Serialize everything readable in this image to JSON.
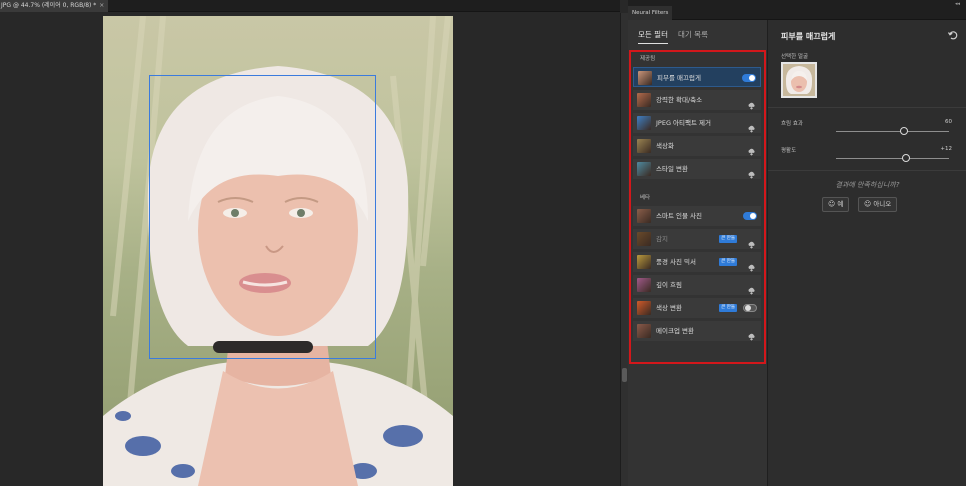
{
  "document": {
    "tab_title": "JPG @ 44.7% (레이어 0, RGB/8) *",
    "close_glyph": "×"
  },
  "panel": {
    "title": "Neural Filters",
    "tabs": [
      {
        "label": "모든 필터",
        "active": true
      },
      {
        "label": "대기 목록",
        "active": false
      }
    ],
    "sections": [
      {
        "label": "제공됨",
        "items": [
          {
            "name": "피부를 매끄럽게",
            "thumb": "#c9957a",
            "state": "toggle-on",
            "selected": true
          },
          {
            "name": "강력한 확대/축소",
            "thumb": "#b36b4c",
            "state": "cloud"
          },
          {
            "name": "JPEG 아티팩트 제거",
            "thumb": "#3f7fc4",
            "state": "cloud"
          },
          {
            "name": "색상화",
            "thumb": "#9a8452",
            "state": "cloud"
          },
          {
            "name": "스타일 변환",
            "thumb": "#4f8aa0",
            "state": "cloud"
          }
        ]
      },
      {
        "label": "베타",
        "items": [
          {
            "name": "스마트 인물 사진",
            "thumb": "#8a5e4a",
            "state": "toggle-on"
          },
          {
            "name": "감지",
            "thumb": "#6a4a2a",
            "state": "cloud",
            "badge": "큰 만들",
            "dim": true
          },
          {
            "name": "풍경 사진 믹서",
            "thumb": "#b99a3e",
            "state": "cloud",
            "badge": "큰 만들"
          },
          {
            "name": "깊이 흐림",
            "thumb": "#a05a8a",
            "state": "cloud"
          },
          {
            "name": "색상 변환",
            "thumb": "#d05a2a",
            "state": "toggle-off",
            "badge": "큰 만들"
          },
          {
            "name": "메이크업 변환",
            "thumb": "#8a5a4a",
            "state": "cloud"
          }
        ]
      }
    ]
  },
  "settings": {
    "title": "피부를 매끄럽게",
    "selected_face_label": "선택한 얼굴",
    "sliders": [
      {
        "label": "흐림 효과",
        "value": 60,
        "display": "60",
        "min": 0,
        "max": 100
      },
      {
        "label": "평활도",
        "value": 12,
        "display": "+12",
        "min": -50,
        "max": 50
      }
    ],
    "feedback_question": "결과에 만족하십니까?",
    "yes_label": "예",
    "no_label": "아니오"
  },
  "colors": {
    "accent": "#2f7bd8",
    "highlight_frame": "#d3171b",
    "face_box": "#3b7bdd"
  }
}
